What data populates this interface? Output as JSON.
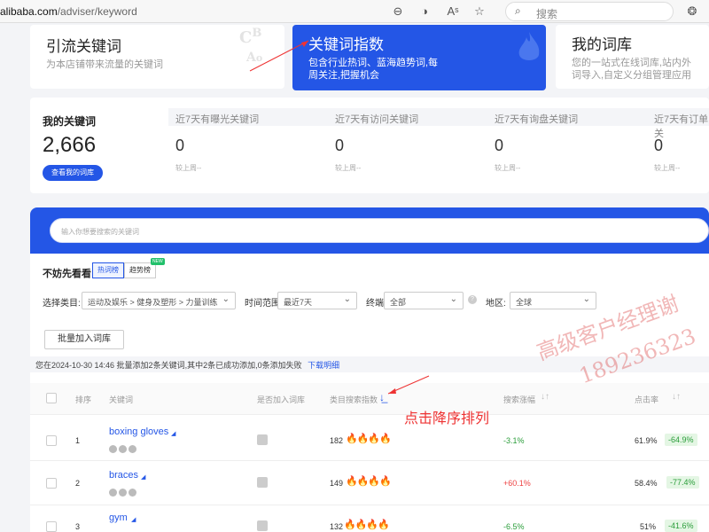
{
  "browser": {
    "url_host": "alibaba.com",
    "url_path": "/adviser/keyword",
    "search_placeholder": "搜索"
  },
  "top_cards": [
    {
      "title": "引流关键词",
      "desc": "为本店铺带来流量的关键词"
    },
    {
      "title": "关键词指数",
      "desc_line1": "包含行业热词、蓝海趋势词,每",
      "desc_line2": "周关注,把握机会"
    },
    {
      "title": "我的词库",
      "desc_line1": "您的一站式在线词库,站内外",
      "desc_line2": "词导入,自定义分组管理应用"
    }
  ],
  "stats": {
    "my_keywords_label": "我的关键词",
    "my_keywords_count": "2,666",
    "view_library_button": "查看我的词库",
    "columns": [
      {
        "label": "近7天有曝光关键词",
        "value": "0",
        "sub": "较上周--"
      },
      {
        "label": "近7天有访问关键词",
        "value": "0",
        "sub": "较上周--"
      },
      {
        "label": "近7天有询盘关键词",
        "value": "0",
        "sub": "较上周--"
      },
      {
        "label": "近7天有订单关",
        "value": "0",
        "sub": "较上周--"
      }
    ]
  },
  "search": {
    "placeholder": "输入你想要搜索的关键词"
  },
  "discover": {
    "label": "不妨先看看",
    "tab_hot": "热词榜",
    "tab_trend": "趋势榜",
    "new_badge": "NEW"
  },
  "filters": {
    "category_label": "选择类目:",
    "category_value": "运动及娱乐 > 健身及塑形 > 力量训练",
    "time_label": "时间范围:",
    "time_value": "最近7天",
    "device_label": "终端:",
    "device_value": "全部",
    "region_label": "地区:",
    "region_value": "全球"
  },
  "batch_add_button": "批量加入词库",
  "batch_notice": {
    "text": "您在2024-10-30 14:46 批量添加2条关键词,其中2条已成功添加,0条添加失败",
    "link": "下载明细"
  },
  "table": {
    "headers": {
      "rank": "排序",
      "keyword": "关键词",
      "added": "是否加入词库",
      "search_index": "类目搜索指数",
      "search_growth": "搜索涨幅",
      "ctr": "点击率"
    },
    "rows": [
      {
        "rank": "1",
        "keyword": "boxing gloves",
        "index": "182",
        "growth": "-3.1%",
        "ctr": "61.9%",
        "ctr_change": "-64.9%"
      },
      {
        "rank": "2",
        "keyword": "braces",
        "index": "149",
        "growth": "+60.1%",
        "ctr": "58.4%",
        "ctr_change": "-77.4%"
      },
      {
        "rank": "3",
        "keyword": "gym",
        "index": "132",
        "growth": "-6.5%",
        "ctr": "51%",
        "ctr_change": "-41.6%"
      }
    ]
  },
  "annotation": {
    "click_sort": "点击降序排列",
    "watermark_line1": "高级客户经理谢",
    "watermark_line2": "189236323"
  },
  "colors": {
    "brand_blue": "#2456e6",
    "annotation_red": "#e33"
  }
}
